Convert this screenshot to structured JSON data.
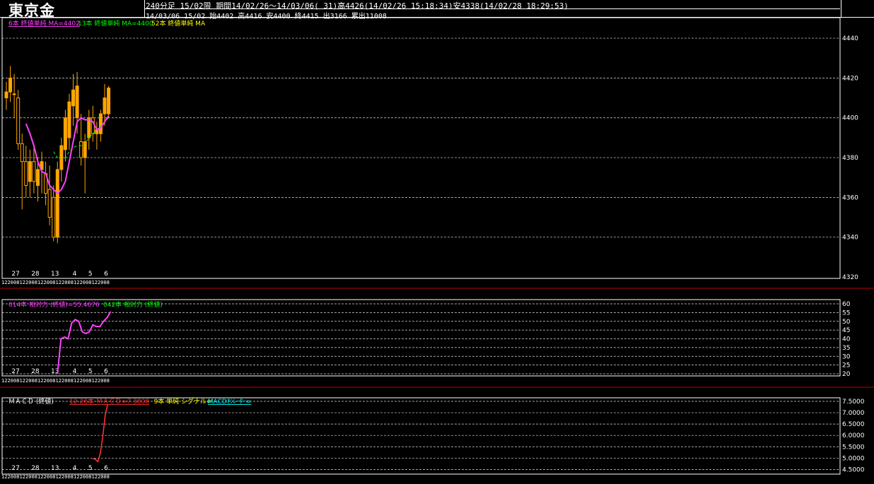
{
  "header": {
    "title": "東京金",
    "line1": "240分足 15/02限  期間14/02/26～14/03/06( 31)高4426(14/02/26 15:18:34)安4338(14/02/28 18:29:53)",
    "line2": "14/03/06 15/02 始4402 高4416 安4400 終4415 出3166 累出11008"
  },
  "colors": {
    "candle": "#FFA500",
    "ma6": "#FF40FF",
    "ma13": "#00FF00",
    "ma52": "#FFFF00",
    "rsi14": "#FF40FF",
    "rsi42": "#00FF00",
    "macd": "#FF3030",
    "signal": "#FFFF00",
    "oscillator": "#00FFFF",
    "separator": "#C00000",
    "grid": "#FFFFFF"
  },
  "x_axis": {
    "day_labels": [
      "27",
      "28",
      "13",
      "4",
      "5",
      "6"
    ],
    "hour_labels": [
      "12",
      "20",
      "08",
      "12",
      "20",
      "08",
      "12",
      "20",
      "08",
      "12",
      "20",
      "08",
      "12",
      "20",
      "08",
      "12",
      "20",
      "08"
    ]
  },
  "chart_data": [
    {
      "type": "candlestick",
      "legend": [
        {
          "text": "6本 終値単純 MA=4402",
          "color": "#FF40FF"
        },
        {
          "text": "13本 終値単純 MA=4400",
          "color": "#00FF00"
        },
        {
          "text": "52本 終値単純 MA",
          "color": "#FFFF00"
        }
      ],
      "yticks": [
        4440,
        4420,
        4400,
        4380,
        4360,
        4340,
        4320
      ],
      "ylim": [
        4320,
        4445
      ],
      "candles": [
        {
          "o": 4410,
          "h": 4418,
          "l": 4404,
          "c": 4413
        },
        {
          "o": 4413,
          "h": 4426,
          "l": 4408,
          "c": 4420
        },
        {
          "o": 4412,
          "h": 4422,
          "l": 4400,
          "c": 4412
        },
        {
          "o": 4410,
          "h": 4414,
          "l": 4384,
          "c": 4387
        },
        {
          "o": 4387,
          "h": 4392,
          "l": 4354,
          "c": 4378
        },
        {
          "o": 4378,
          "h": 4386,
          "l": 4360,
          "c": 4366
        },
        {
          "o": 4368,
          "h": 4384,
          "l": 4360,
          "c": 4378
        },
        {
          "o": 4378,
          "h": 4385,
          "l": 4362,
          "c": 4368
        },
        {
          "o": 4366,
          "h": 4380,
          "l": 4358,
          "c": 4374
        },
        {
          "o": 4374,
          "h": 4383,
          "l": 4362,
          "c": 4378
        },
        {
          "o": 4372,
          "h": 4378,
          "l": 4356,
          "c": 4362
        },
        {
          "o": 4364,
          "h": 4376,
          "l": 4346,
          "c": 4350
        },
        {
          "o": 4360,
          "h": 4366,
          "l": 4338,
          "c": 4340
        },
        {
          "o": 4340,
          "h": 4378,
          "l": 4337,
          "c": 4374
        },
        {
          "o": 4374,
          "h": 4390,
          "l": 4368,
          "c": 4386
        },
        {
          "o": 4384,
          "h": 4404,
          "l": 4378,
          "c": 4400
        },
        {
          "o": 4390,
          "h": 4412,
          "l": 4384,
          "c": 4408
        },
        {
          "o": 4406,
          "h": 4422,
          "l": 4396,
          "c": 4414
        },
        {
          "o": 4400,
          "h": 4423,
          "l": 4392,
          "c": 4416
        },
        {
          "o": 4388,
          "h": 4402,
          "l": 4376,
          "c": 4380
        },
        {
          "o": 4380,
          "h": 4392,
          "l": 4362,
          "c": 4388
        },
        {
          "o": 4390,
          "h": 4404,
          "l": 4384,
          "c": 4400
        },
        {
          "o": 4400,
          "h": 4406,
          "l": 4388,
          "c": 4392
        },
        {
          "o": 4392,
          "h": 4398,
          "l": 4384,
          "c": 4394
        },
        {
          "o": 4392,
          "h": 4404,
          "l": 4388,
          "c": 4402
        },
        {
          "o": 4402,
          "h": 4417,
          "l": 4396,
          "c": 4410
        },
        {
          "o": 4402,
          "h": 4416,
          "l": 4400,
          "c": 4415
        }
      ],
      "ma6": [
        null,
        null,
        null,
        null,
        null,
        4397,
        4392,
        4386,
        4378,
        4373,
        4372,
        4366,
        4364,
        4362,
        4364,
        4368,
        4378,
        4388,
        4398,
        4400,
        4399,
        4399,
        4398,
        4394,
        4395,
        4398,
        4401
      ],
      "ma13": [
        null,
        null,
        null,
        null,
        null,
        null,
        null,
        null,
        null,
        null,
        null,
        null,
        4383,
        4380,
        4379,
        4380,
        4383,
        4385,
        4386,
        4386,
        4387,
        4390,
        4392,
        4394,
        4396,
        4398,
        4400
      ]
    },
    {
      "type": "line",
      "legend": [
        {
          "text": "014本 相対力 (終値)=55.4676",
          "color": "#FF40FF"
        },
        {
          "text": "042本 相対力 (終値)",
          "color": "#00FF00"
        }
      ],
      "yticks": [
        60,
        55,
        50,
        45,
        40,
        35,
        30,
        25,
        20
      ],
      "ylim": [
        20,
        60
      ],
      "x_start_index": 13,
      "values": [
        20,
        40,
        41,
        40,
        49,
        51,
        50,
        44,
        43,
        44,
        48,
        47,
        47,
        50,
        52,
        55.5
      ]
    },
    {
      "type": "line",
      "legend_prefix": "ＭＡＣＤ (終値)",
      "legend": [
        {
          "text": "12-26本 ＭＡＣＤ=7.3808",
          "color": "#FF3030"
        },
        {
          "text": "9本 単純 シグナル=",
          "color": "#FFFF00"
        },
        {
          "text": "MACDｵｼﾚｰﾀｰ=",
          "color": "#00FFFF"
        }
      ],
      "yticks": [
        "7.5000",
        "7.0000",
        "6.5000",
        "6.0000",
        "5.5000",
        "5.0000",
        "4.5000"
      ],
      "ylim": [
        4.45,
        7.5
      ],
      "x_start_index": 22,
      "values": [
        4.98,
        4.95,
        4.84,
        5.2,
        5.95,
        6.9,
        7.38
      ]
    }
  ]
}
